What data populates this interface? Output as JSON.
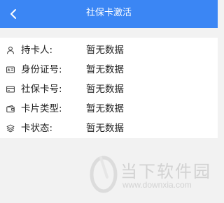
{
  "header": {
    "title": "社保卡激活",
    "back_icon": "chevron-left-icon"
  },
  "info": {
    "rows": [
      {
        "icon": "person-icon",
        "label": "持卡人:",
        "value": "暂无数据"
      },
      {
        "icon": "id-card-icon",
        "label": "身份证号:",
        "value": "暂无数据"
      },
      {
        "icon": "card-icon",
        "label": "社保卡号:",
        "value": "暂无数据"
      },
      {
        "icon": "wallet-icon",
        "label": "卡片类型:",
        "value": "暂无数据"
      },
      {
        "icon": "layers-icon",
        "label": "卡状态:",
        "value": "暂无数据"
      }
    ]
  },
  "watermark": {
    "text": "当下软件园",
    "url": "www.downxia.com"
  },
  "colors": {
    "header": "#3b86f4",
    "background": "#f2f2f2"
  }
}
